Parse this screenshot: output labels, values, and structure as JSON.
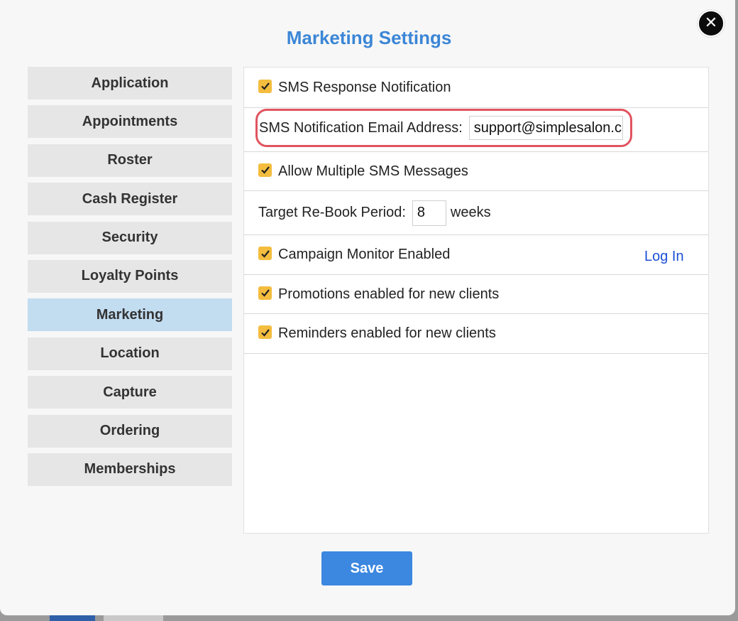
{
  "modal": {
    "title": "Marketing Settings",
    "close_icon": "close-icon",
    "save_label": "Save"
  },
  "nav": {
    "items": [
      {
        "label": "Application",
        "active": false
      },
      {
        "label": "Appointments",
        "active": false
      },
      {
        "label": "Roster",
        "active": false
      },
      {
        "label": "Cash Register",
        "active": false
      },
      {
        "label": "Security",
        "active": false
      },
      {
        "label": "Loyalty Points",
        "active": false
      },
      {
        "label": "Marketing",
        "active": true
      },
      {
        "label": "Location",
        "active": false
      },
      {
        "label": "Capture",
        "active": false
      },
      {
        "label": "Ordering",
        "active": false
      },
      {
        "label": "Memberships",
        "active": false
      }
    ]
  },
  "settings": {
    "sms_response": {
      "label": "SMS Response Notification",
      "checked": true
    },
    "sms_email": {
      "label": "SMS Notification Email Address:",
      "value": "support@simplesalon.com"
    },
    "multi_sms": {
      "label": "Allow Multiple SMS Messages",
      "checked": true
    },
    "rebook": {
      "label": "Target Re-Book Period:",
      "value": "8",
      "unit": "weeks"
    },
    "campaign_monitor": {
      "label": "Campaign Monitor Enabled",
      "checked": true,
      "link": "Log In"
    },
    "promotions": {
      "label": "Promotions enabled for new clients",
      "checked": true
    },
    "reminders": {
      "label": "Reminders enabled for new clients",
      "checked": true
    }
  },
  "colors": {
    "title": "#3b86d6",
    "checkbox": "#f4bd3e",
    "active_nav": "#c2dcf0",
    "highlight": "#e0545f",
    "save_button": "#3c87e0"
  }
}
